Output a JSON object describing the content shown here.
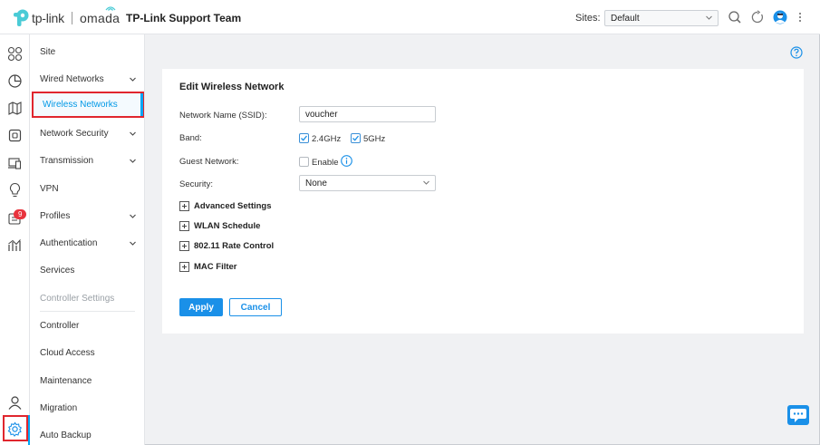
{
  "brand": {
    "tplink": "tp-link",
    "omada": "omada",
    "site_title": "TP-Link Support Team",
    "accent": "#1a90e8",
    "highlight": "#e0262e"
  },
  "header": {
    "sites_label": "Sites:",
    "sites_value": "Default",
    "icons": [
      "search-icon",
      "refresh-icon",
      "user-avatar-icon",
      "more-icon"
    ]
  },
  "rail": {
    "icons": [
      "dashboard-icon",
      "statistics-icon",
      "map-icon",
      "devices-icon",
      "clients-icon",
      "insight-icon",
      "log-icon",
      "reports-icon",
      "account-icon",
      "settings-icon"
    ],
    "badge": "9"
  },
  "nav": {
    "items": [
      {
        "label": "Site"
      },
      {
        "label": "Wired Networks"
      },
      {
        "label": "Wireless Networks"
      },
      {
        "label": "Network Security"
      },
      {
        "label": "Transmission"
      },
      {
        "label": "VPN"
      },
      {
        "label": "Profiles"
      },
      {
        "label": "Authentication"
      },
      {
        "label": "Services"
      },
      {
        "label": "Controller Settings"
      },
      {
        "label": "Controller"
      },
      {
        "label": "Cloud Access"
      },
      {
        "label": "Maintenance"
      },
      {
        "label": "Migration"
      },
      {
        "label": "Auto Backup"
      }
    ]
  },
  "form": {
    "title": "Edit Wireless Network",
    "ssid_label": "Network Name (SSID):",
    "ssid_value": "voucher",
    "band_label": "Band:",
    "band_24": "2.4GHz",
    "band_5": "5GHz",
    "guest_label": "Guest Network:",
    "guest_option": "Enable",
    "security_label": "Security:",
    "security_value": "None",
    "sections": [
      "Advanced Settings",
      "WLAN Schedule",
      "802.11 Rate Control",
      "MAC Filter"
    ],
    "apply": "Apply",
    "cancel": "Cancel"
  }
}
